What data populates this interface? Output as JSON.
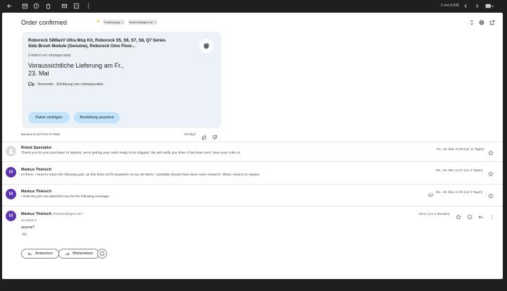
{
  "toolbar": {
    "count": "2 von 6.936",
    "icons": [
      "back-icon",
      "archive-icon",
      "report-icon",
      "delete-icon",
      "mail-icon",
      "snooze-icon",
      "more-icon",
      "prev-icon",
      "next-icon",
      "keyboard-icon"
    ]
  },
  "header": {
    "subject": "Order confirmed",
    "labels": [
      {
        "text": "Posteingang",
        "close": "×"
      },
      {
        "text": "fischmob@gmx.de",
        "close": "×"
      }
    ]
  },
  "card": {
    "title": "Roborock S8MaxV Ultra Mop Kit, Roborock S5, S6, S7, S8, Q7 Series Side Brush Module (Genuine), Roborock Omo Floor...",
    "subtitle": "3 Artikel von robotspecialist",
    "delivery_line1": "Voraussichtliche Lieferung am Fr.,",
    "delivery_line2": "23. Mai",
    "shipping": "Versendet · Schätzung von robotspecialist",
    "track_button": "Paket verfolgen",
    "view_button": "Bestellung ansehen"
  },
  "feedback": {
    "based_on": "Basierend auf Ihren E-Mails",
    "helpful": "Richtig?"
  },
  "messages": [
    {
      "sender": "Robot Specialist",
      "avatar": "",
      "snippet": "Thank you for your purchase! Hi Markus, we're getting your order ready to be shipped. We will notify you when it has been sent. View your order or",
      "date": "So., 18. Mai, 16:33 (vor 11 Tagen)"
    },
    {
      "sender": "Markus Thielsch",
      "avatar": "M",
      "snippet": "Hi there, I need to return the following part, as this does not fit anywhere on my S8 MaxV. I probably should have done more research. What I need is to replace",
      "date": "Mo., 26. Mai, 14:07 (vor 3 Tagen)"
    },
    {
      "sender": "Markus Thielsch",
      "avatar": "M",
      "snippet": "I think the pics are attached now for the following message:",
      "date": "Mo., 26. Mai, 14:09 (vor 3 Tagen)"
    },
    {
      "sender": "Markus Thielsch",
      "email": "<fischmob@gmx.de>",
      "avatar": "M",
      "to": "an Robot",
      "to_arrow": "▾",
      "body": "anyone?",
      "dots": "•••",
      "date": "03:41 (vor 4 Stunden)"
    }
  ],
  "actions": {
    "reply": "Antworten",
    "forward": "Weiterleiten"
  },
  "colors": {
    "card_bg": "#edf2f8",
    "pill_bg": "#c2e3fc",
    "avatar_purple": "#5e35b1",
    "label_arrow": "#f2b600"
  }
}
